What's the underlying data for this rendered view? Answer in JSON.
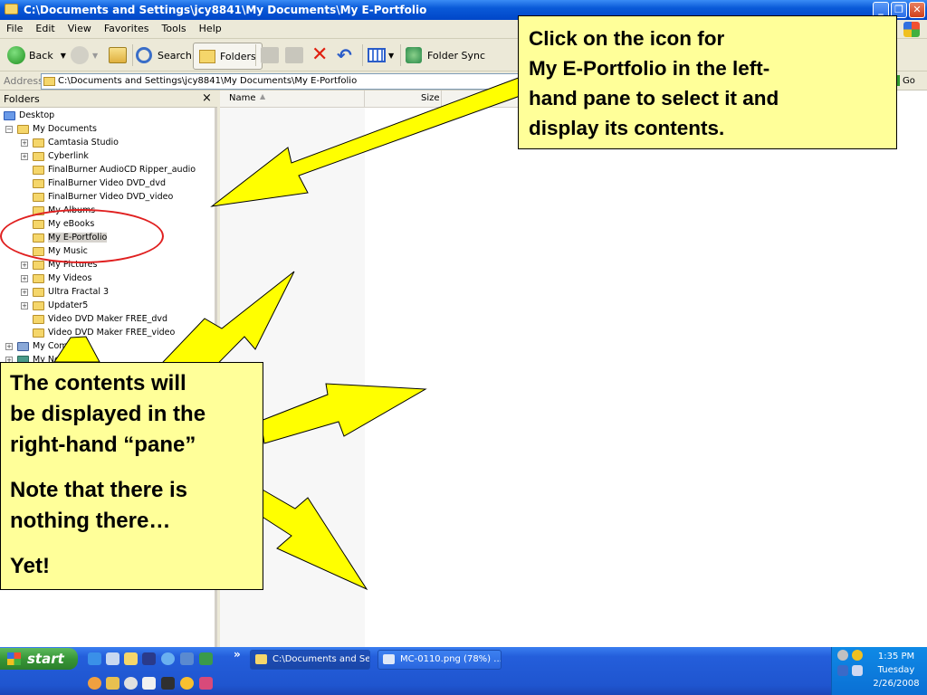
{
  "window": {
    "title": "C:\\Documents and Settings\\jcy8841\\My Documents\\My E-Portfolio",
    "minimize": "_",
    "maximize": "❐",
    "close": "✕"
  },
  "menu": [
    "File",
    "Edit",
    "View",
    "Favorites",
    "Tools",
    "Help"
  ],
  "toolbar": {
    "back_label": "Back",
    "search_label": "Search",
    "folders_label": "Folders",
    "folder_sync_label": "Folder Sync"
  },
  "address": {
    "label": "Address",
    "value": "C:\\Documents and Settings\\jcy8841\\My Documents\\My E-Portfolio",
    "go_label": "Go"
  },
  "folders_pane": {
    "header": "Folders",
    "close": "×",
    "items": [
      {
        "label": "Desktop",
        "expander": ""
      },
      {
        "label": "My Documents",
        "expander": "−"
      },
      {
        "label": "Camtasia Studio",
        "expander": "+"
      },
      {
        "label": "Cyberlink",
        "expander": "+"
      },
      {
        "label": "FinalBurner AudioCD Ripper_audio",
        "expander": ""
      },
      {
        "label": "FinalBurner Video DVD_dvd",
        "expander": ""
      },
      {
        "label": "FinalBurner Video DVD_video",
        "expander": ""
      },
      {
        "label": "My Albums",
        "expander": ""
      },
      {
        "label": "My eBooks",
        "expander": ""
      },
      {
        "label": "My E-Portfolio",
        "expander": "",
        "selected": true
      },
      {
        "label": "My Music",
        "expander": ""
      },
      {
        "label": "My Pictures",
        "expander": "+"
      },
      {
        "label": "My Videos",
        "expander": "+"
      },
      {
        "label": "Ultra Fractal 3",
        "expander": "+"
      },
      {
        "label": "Updater5",
        "expander": "+"
      },
      {
        "label": "Video DVD Maker FREE_dvd",
        "expander": ""
      },
      {
        "label": "Video DVD Maker FREE_video",
        "expander": ""
      },
      {
        "label": "My Com",
        "expander": "+"
      },
      {
        "label": "My Net",
        "expander": "+"
      }
    ]
  },
  "columns": {
    "name": "Name",
    "size": "Size"
  },
  "callouts": {
    "top_right": [
      "Click on the icon for",
      "My E-Portfolio in the left-",
      "hand pane to select it and",
      "display its contents."
    ],
    "left": {
      "p1": [
        "The contents will",
        "be displayed in the",
        "right-hand “pane”"
      ],
      "p2": [
        "Note that there is",
        "nothing there…"
      ],
      "p3": "Yet!"
    }
  },
  "taskbar": {
    "start": "start",
    "chevron": "»",
    "tasks": [
      "C:\\Documents and Se...",
      "MC-0110.png (78%) ..."
    ],
    "clock": {
      "time": "1:35 PM",
      "day": "Tuesday",
      "date": "2/26/2008"
    }
  },
  "colors": {
    "callout_bg": "#ffff99",
    "arrow_fill": "#ffff00",
    "highlight_circle": "#e02020",
    "titlebar": "#0a5ad8",
    "taskbar": "#245edb",
    "start_green": "#379637"
  }
}
